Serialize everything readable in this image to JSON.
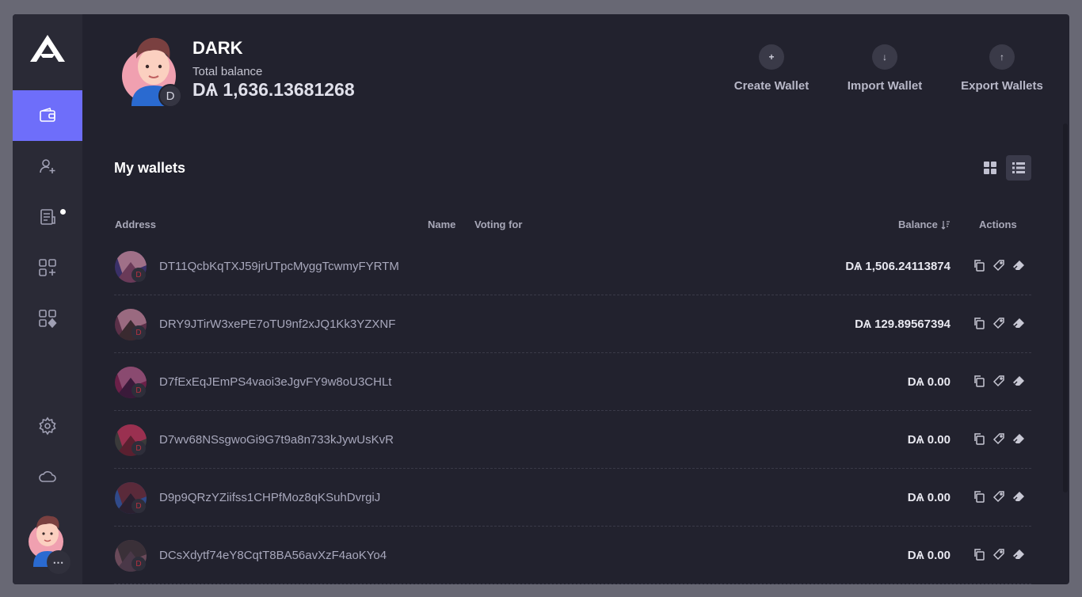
{
  "sidebar": {
    "items": [
      {
        "icon": "wallet-icon",
        "active": true
      },
      {
        "icon": "add-contact-icon",
        "active": false
      },
      {
        "icon": "transactions-icon",
        "active": false,
        "notification": true
      },
      {
        "icon": "plugin-add-icon",
        "active": false
      },
      {
        "icon": "plugin-manager-icon",
        "active": false
      },
      {
        "icon": "settings-icon",
        "active": false
      },
      {
        "icon": "cloud-icon",
        "active": false
      }
    ],
    "more_label": "⋯"
  },
  "profile": {
    "name": "DARK",
    "badge": "D",
    "balance_label": "Total balance",
    "balance": "DѦ 1,636.13681268"
  },
  "header_actions": {
    "create": {
      "label": "Create Wallet",
      "icon": "+"
    },
    "import": {
      "label": "Import Wallet",
      "icon": "↓"
    },
    "export": {
      "label": "Export Wallets",
      "icon": "↑"
    }
  },
  "wallets_section": {
    "title": "My wallets",
    "columns": {
      "address": "Address",
      "name": "Name",
      "voting": "Voting for",
      "balance": "Balance",
      "actions": "Actions"
    },
    "rows": [
      {
        "address": "DT11QcbKqTXJ59jrUTpcMyggTcwmyFYRTM",
        "balance": "DѦ 1,506.24113874",
        "badge": "D",
        "colors": [
          "#3a3068",
          "#a07088",
          "#6a3a58"
        ]
      },
      {
        "address": "DRY9JTirW3xePE7oTU9nf2xJQ1Kk3YZXNF",
        "balance": "DѦ 129.89567394",
        "badge": "D",
        "colors": [
          "#5a3048",
          "#9a6a80",
          "#3a2a30"
        ]
      },
      {
        "address": "D7fExEqJEmPS4vaoi3eJgvFY9w8oU3CHLt",
        "balance": "DѦ 0.00",
        "badge": "D",
        "colors": [
          "#6a2048",
          "#8a4a70",
          "#3a1a3a"
        ]
      },
      {
        "address": "D7wv68NSsgwoGi9G7t9a8n733kJywUsKvR",
        "balance": "DѦ 0.00",
        "badge": "D",
        "colors": [
          "#3a3a3a",
          "#9a3050",
          "#5a2030"
        ]
      },
      {
        "address": "D9p9QRzYZiifss1CHPfMoz8qKSuhDvrgiJ",
        "balance": "DѦ 0.00",
        "badge": "D",
        "colors": [
          "#304a8a",
          "#5a2a3a",
          "#2a2030"
        ]
      },
      {
        "address": "DCsXdytf74eY8CqtT8BA56avXzF4aoKYo4",
        "balance": "DѦ 0.00",
        "badge": "D",
        "colors": [
          "#6a4a5a",
          "#3a3038",
          "#4a3848"
        ]
      }
    ]
  },
  "colors": {
    "accent": "#6e6efa",
    "background": "#22222e",
    "sidebar": "#2a2a36"
  }
}
